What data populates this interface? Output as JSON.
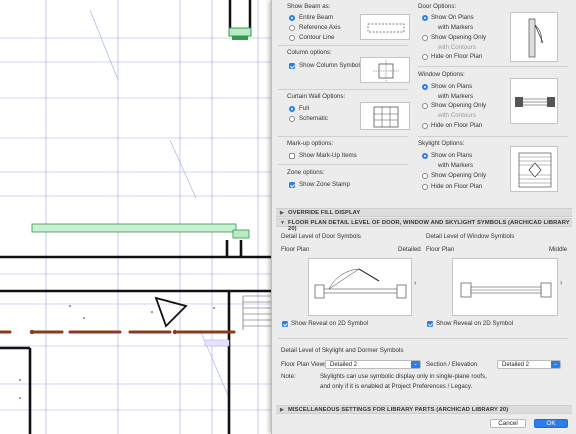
{
  "beam": {
    "title": "Show Beam as:",
    "options": [
      "Entire Beam",
      "Reference Axis",
      "Contour Line"
    ],
    "selected": "Entire Beam"
  },
  "column": {
    "title": "Column options:",
    "show_symbol_label": "Show Column Symbol",
    "show_symbol_checked": true
  },
  "curtain_wall": {
    "title": "Curtain Wall Options:",
    "options": [
      "Full",
      "Schematic"
    ],
    "selected": "Full"
  },
  "markup": {
    "title": "Mark-up options:",
    "show_label": "Show Mark-Up Items",
    "checked": false
  },
  "zone": {
    "title": "Zone options:",
    "show_label": "Show Zone Stamp",
    "checked": true
  },
  "door": {
    "title": "Door Options:",
    "show_on_plans": "Show On Plans",
    "with_markers_1": "with Markers",
    "show_opening_only": "Show Opening Only",
    "with_contours": "with Contours",
    "hide": "Hide on Floor Plan",
    "selected": "Show On Plans"
  },
  "window": {
    "title": "Window Options:",
    "show_on_plans": "Show on Plans",
    "with_markers_1": "with Markers",
    "show_opening_only": "Show Opening Only",
    "with_contours": "with Contours",
    "hide": "Hide on Floor Plan",
    "selected": "Show on Plans"
  },
  "skylight": {
    "title": "Skylight Options:",
    "show_on_plans": "Show on Plans",
    "with_markers_1": "with Markers",
    "show_opening_only": "Show Opening Only",
    "hide": "Hide on Floor Plan",
    "selected": "Show on Plans"
  },
  "sections": {
    "override_fill": "OVERRIDE FILL DISPLAY",
    "detail_level": "FLOOR PLAN DETAIL LEVEL OF DOOR, WINDOW AND SKYLIGHT SYMBOLS (ARCHICAD LIBRARY 20)",
    "misc": "MISCELLANEOUS SETTINGS FOR LIBRARY PARTS (ARCHICAD LIBRARY 20)"
  },
  "detail": {
    "door_title": "Detail Level of Door Symbols",
    "door_floor_plan": "Floor Plan",
    "door_level": "Detailed",
    "door_reveal_label": "Show Reveal on 2D Symbol",
    "door_reveal_checked": true,
    "window_title": "Detail Level of Window Symbols",
    "window_floor_plan": "Floor Plan",
    "window_level": "Middle",
    "window_reveal_label": "Show Reveal on 2D Symbol",
    "window_reveal_checked": true,
    "skylight_title": "Detail Level of Skylight and Dormer Symbols",
    "floor_plan_views_label": "Floor Plan Views",
    "floor_plan_views_value": "Detailed 2",
    "section_elev_label": "Section / Elevation",
    "section_elev_value": "Detailed 2",
    "note_label": "Note:",
    "note_line1": "Skylights can use symbolic display only in single-plane roofs,",
    "note_line2": "and only if it is enabled at Project Preferences / Legacy."
  },
  "buttons": {
    "cancel": "Cancel",
    "ok": "OK"
  },
  "colors": {
    "accent": "#2b7de9",
    "beam_green": "#2f9a4a",
    "beam_brown": "#8b3a1e"
  }
}
